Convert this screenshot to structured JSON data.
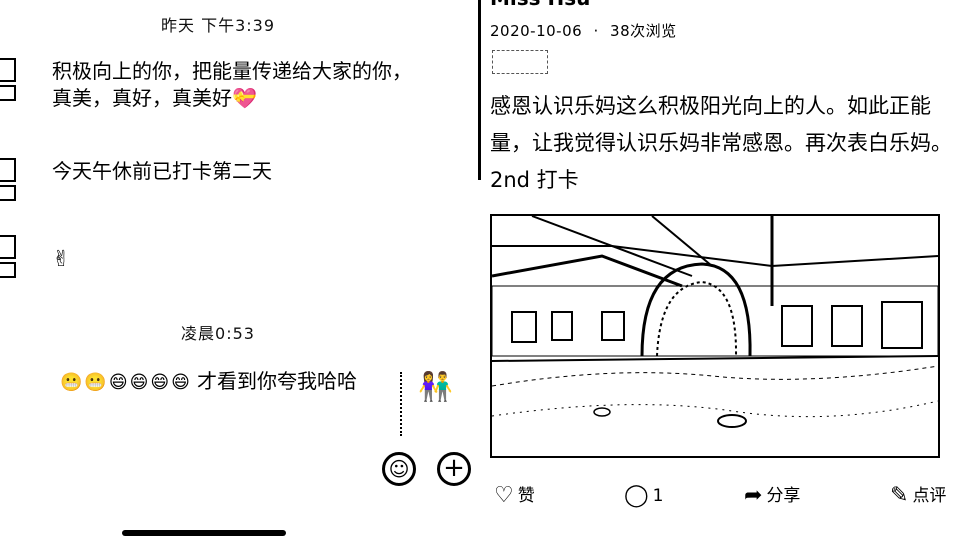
{
  "chat": {
    "timestamp_1": "昨天 下午3:39",
    "messages": [
      {
        "text": "积极向上的你，把能量传递给大家的你，真美，真好，真美好💝"
      },
      {
        "text": "今天午休前已打卡第二天"
      },
      {
        "text": "✌"
      }
    ],
    "timestamp_2": "凌晨0:53",
    "reply": {
      "faces": "😬😬😄😄😄😄",
      "text": "才看到你夸我哈哈"
    },
    "sticker_icon": "couple-sticker-icon",
    "emoji_button": "☺",
    "plus_button": "+"
  },
  "post": {
    "author": "Miss Hsu",
    "date": "2020-10-06",
    "separator": "·",
    "views": "38次浏览",
    "tag": "",
    "body": "感恩认识乐妈这么积极阳光向上的人。如此正能量，让我觉得认识乐妈非常感恩。再次表白乐妈。2nd 打卡",
    "actions": {
      "like_label": "赞",
      "comment_count": "1",
      "share_label": "分享",
      "review_label": "点评"
    }
  },
  "icons": {
    "like": "heart-outline-icon",
    "comment": "speech-bubble-icon",
    "share": "share-arrow-icon",
    "review": "edit-square-icon"
  }
}
